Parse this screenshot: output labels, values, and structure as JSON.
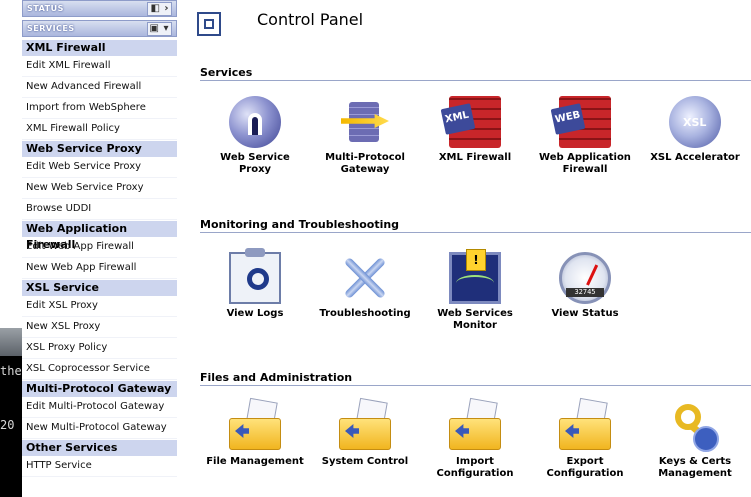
{
  "sidebar": {
    "status_header": "STATUS",
    "services_header": "SERVICES",
    "groups": [
      {
        "title": "XML Firewall",
        "items": [
          "Edit XML Firewall",
          "New Advanced Firewall",
          "Import from WebSphere",
          "XML Firewall Policy"
        ]
      },
      {
        "title": "Web Service Proxy",
        "items": [
          "Edit Web Service Proxy",
          "New Web Service Proxy",
          "Browse UDDI"
        ]
      },
      {
        "title": "Web Application Firewall",
        "items": [
          "Edit Web App Firewall",
          "New Web App Firewall"
        ]
      },
      {
        "title": "XSL Service",
        "items": [
          "Edit XSL Proxy",
          "New XSL Proxy",
          "XSL Proxy Policy",
          "XSL Coprocessor Service"
        ]
      },
      {
        "title": "Multi-Protocol Gateway",
        "items": [
          "Edit Multi-Protocol Gateway",
          "New Multi-Protocol Gateway"
        ]
      },
      {
        "title": "Other Services",
        "items": [
          "HTTP Service"
        ]
      }
    ]
  },
  "bg_window": {
    "text_top": "the",
    "text_bottom": "20"
  },
  "header": {
    "title": "Control Panel"
  },
  "sections": [
    {
      "title": "Services",
      "tiles": [
        {
          "line1": "Web Service",
          "line2": "Proxy",
          "icon": "web-service-proxy-icon"
        },
        {
          "line1": "Multi-Protocol",
          "line2": "Gateway",
          "icon": "multi-protocol-gateway-icon"
        },
        {
          "line1": "XML Firewall",
          "line2": "",
          "icon": "xml-firewall-icon",
          "tag": "XML"
        },
        {
          "line1": "Web Application",
          "line2": "Firewall",
          "icon": "web-application-firewall-icon",
          "tag": "WEB"
        },
        {
          "line1": "XSL Accelerator",
          "line2": "",
          "icon": "xsl-accelerator-icon",
          "tag": "XSL"
        }
      ]
    },
    {
      "title": "Monitoring and Troubleshooting",
      "tiles": [
        {
          "line1": "View Logs",
          "line2": "",
          "icon": "view-logs-icon"
        },
        {
          "line1": "Troubleshooting",
          "line2": "",
          "icon": "troubleshooting-icon"
        },
        {
          "line1": "Web Services",
          "line2": "Monitor",
          "icon": "web-services-monitor-icon"
        },
        {
          "line1": "View Status",
          "line2": "",
          "icon": "view-status-icon",
          "odometer": "32745"
        }
      ]
    },
    {
      "title": "Files and Administration",
      "tiles": [
        {
          "line1": "File Management",
          "line2": "",
          "icon": "file-management-icon"
        },
        {
          "line1": "System Control",
          "line2": "",
          "icon": "system-control-icon"
        },
        {
          "line1": "Import",
          "line2": "Configuration",
          "icon": "import-configuration-icon"
        },
        {
          "line1": "Export",
          "line2": "Configuration",
          "icon": "export-configuration-icon"
        },
        {
          "line1": "Keys & Certs",
          "line2": "Management",
          "icon": "keys-certs-icon"
        }
      ]
    }
  ],
  "colors": {
    "accent": "#2f4a8a",
    "nav_group_bg": "#cdd5ee",
    "header_gradient": "#aab6dd"
  }
}
